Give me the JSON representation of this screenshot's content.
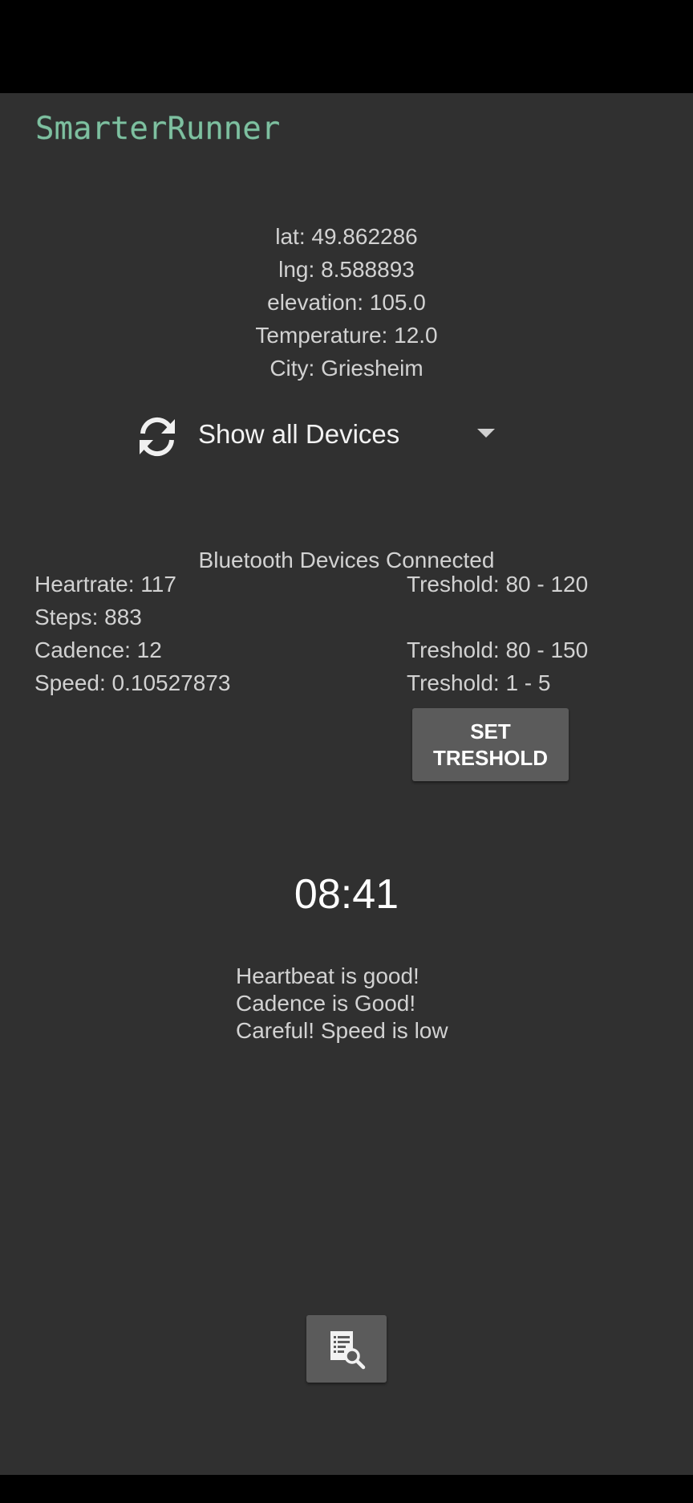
{
  "app": {
    "title": "SmarterRunner"
  },
  "location": {
    "lat": "lat: 49.862286",
    "lng": "lng: 8.588893",
    "elevation": "elevation: 105.0",
    "temperature": "Temperature: 12.0",
    "city": "City: Griesheim"
  },
  "devices": {
    "selected": "Show all Devices",
    "status": "Bluetooth Devices Connected",
    "refresh_icon": "refresh-icon",
    "dropdown_icon": "dropdown-arrow-icon"
  },
  "metrics": {
    "heartrate": "Heartrate: 117",
    "steps": "Steps: 883",
    "cadence": "Cadence: 12",
    "speed": "Speed: 0.10527873"
  },
  "thresholds": {
    "heartrate": "Treshold: 80 - 120",
    "steps": "",
    "cadence": "Treshold: 80 - 150",
    "speed": "Treshold: 1 - 5"
  },
  "set_threshold_button": {
    "label": "SET\nTRESHOLD"
  },
  "timer": {
    "value": "08:41"
  },
  "messages": {
    "heartbeat": "Heartbeat is good!",
    "cadence": "Cadence is Good!",
    "speed": "Careful! Speed is low"
  },
  "log_button": {
    "icon": "log-search-icon"
  },
  "colors": {
    "background": "#303030",
    "title": "#7fc0a0",
    "button": "#5b5b5b",
    "text": "#d2d2d2"
  }
}
